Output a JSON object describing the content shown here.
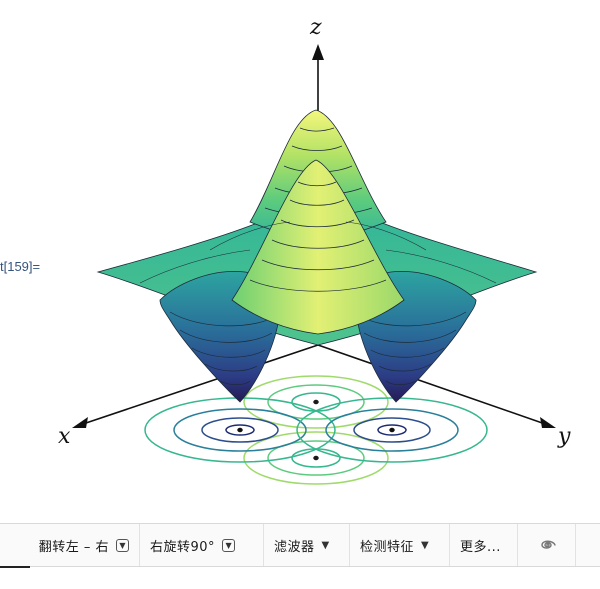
{
  "output": {
    "label": "t[159]="
  },
  "plot": {
    "axes": {
      "x": "x",
      "y": "y",
      "z": "z"
    },
    "colors": {
      "peak": "#f0f27a",
      "mid": "#2fb69a",
      "trough": "#2a1e5a",
      "contour_light": "#37b78f",
      "contour_dark": "#1b2c73"
    }
  },
  "toolbar": {
    "items": [
      {
        "label": "翻转左 – 右",
        "control": "boxed-caret"
      },
      {
        "label": "右旋转90°",
        "control": "boxed-caret"
      },
      {
        "label": "滤波器",
        "control": "caret"
      },
      {
        "label": "检测特征",
        "control": "caret"
      },
      {
        "label": "更多...",
        "control": "none"
      }
    ],
    "spiral_icon": "spiral-icon"
  }
}
